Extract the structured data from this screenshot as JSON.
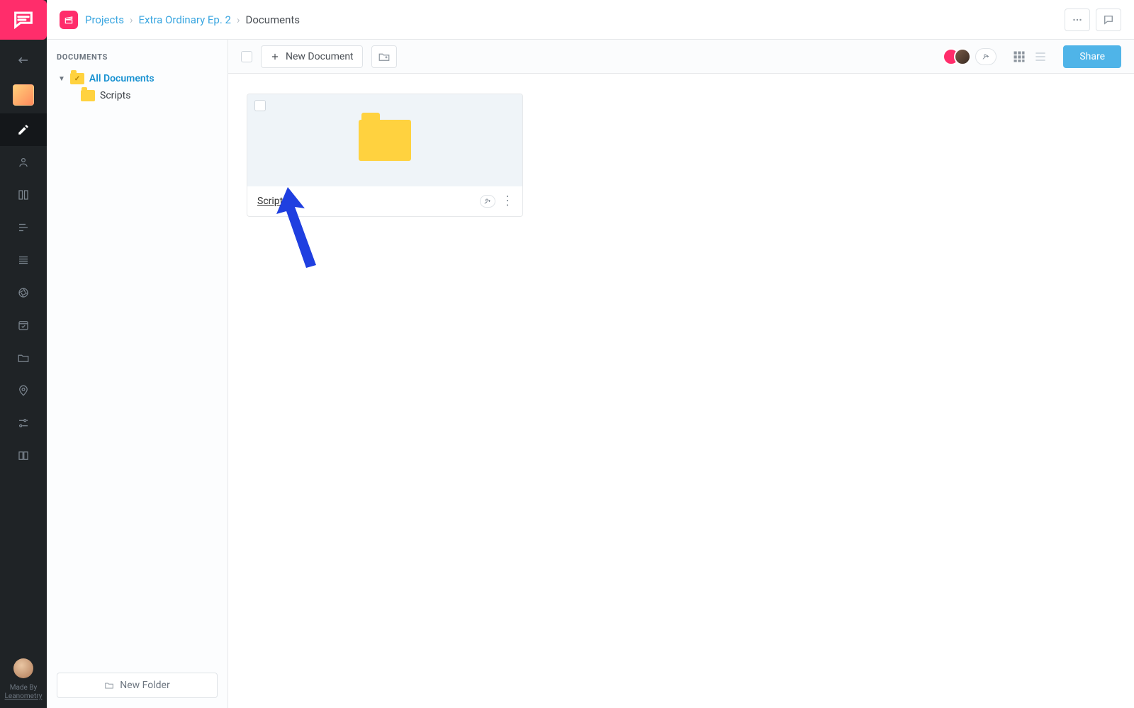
{
  "breadcrumbs": {
    "root": "Projects",
    "project": "Extra Ordinary Ep. 2",
    "current": "Documents"
  },
  "sidebar": {
    "section_title": "DOCUMENTS",
    "root_label": "All Documents",
    "children": [
      {
        "label": "Scripts"
      }
    ],
    "new_folder_label": "New Folder"
  },
  "toolbar": {
    "new_doc_label": "New Document",
    "share_label": "Share"
  },
  "cards": [
    {
      "name": "Scripts"
    }
  ],
  "credit": {
    "by": "Made By",
    "who": "Leanometry"
  },
  "colors": {
    "brand": "#ff2d6b",
    "link": "#3aa6e0",
    "folder": "#ffd23f",
    "primary": "#4fb4e8",
    "arrow": "#1f3fe0"
  }
}
